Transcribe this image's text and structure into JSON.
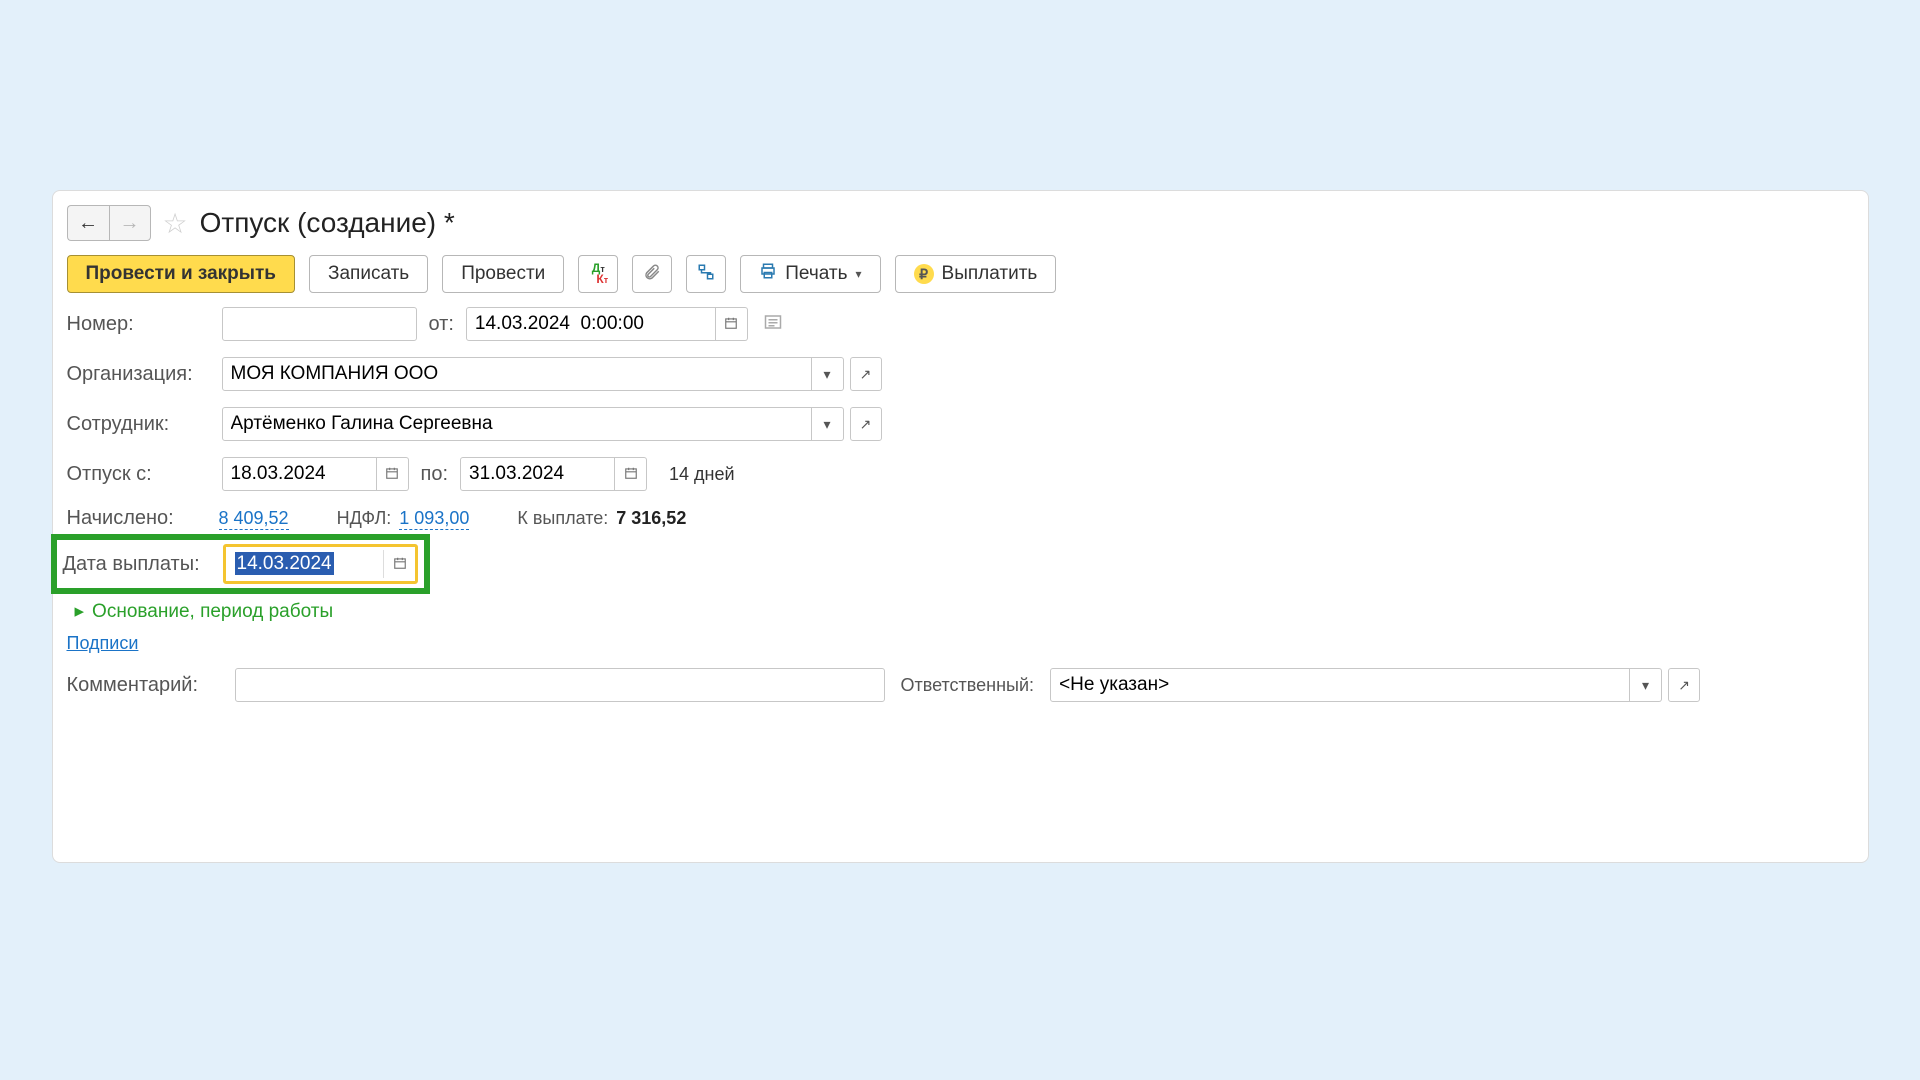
{
  "title": "Отпуск (создание) *",
  "toolbar": {
    "post_and_close": "Провести и закрыть",
    "save": "Записать",
    "post": "Провести",
    "print": "Печать",
    "pay": "Выплатить"
  },
  "labels": {
    "number": "Номер:",
    "from": "от:",
    "org": "Организация:",
    "employee": "Сотрудник:",
    "vac_from": "Отпуск с:",
    "to": "по:",
    "days": "14 дней",
    "accrued": "Начислено:",
    "ndfl": "НДФЛ:",
    "to_pay": "К выплате:",
    "pay_date": "Дата выплаты:",
    "expand": "Основание, период работы",
    "signs": "Подписи",
    "comment": "Комментарий:",
    "responsible": "Ответственный:"
  },
  "values": {
    "number": "",
    "doc_date": "14.03.2024  0:00:00",
    "org": "МОЯ КОМПАНИЯ ООО",
    "employee": "Артёменко Галина Сергеевна",
    "vac_from": "18.03.2024",
    "vac_to": "31.03.2024",
    "accrued": "8 409,52",
    "ndfl": "1 093,00",
    "to_pay": "7 316,52",
    "pay_date": "14.03.2024",
    "comment": "",
    "responsible": "<Не указан>"
  }
}
